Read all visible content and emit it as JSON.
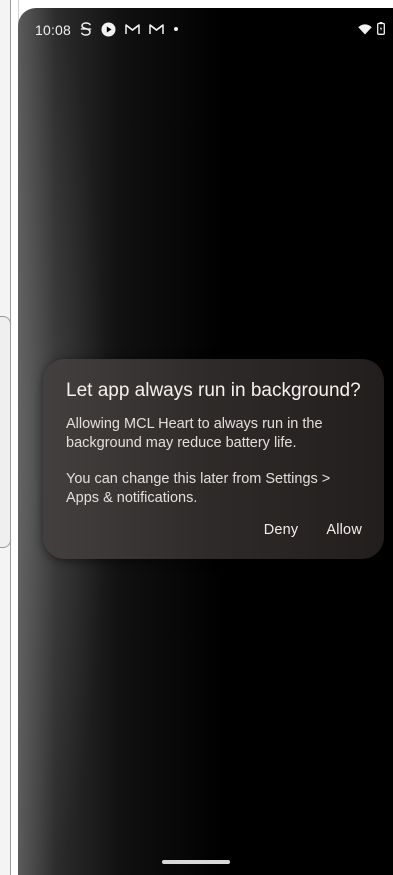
{
  "status_bar": {
    "time": "10:08",
    "left_icons": [
      "s-app-icon",
      "play-circle-icon",
      "gmail-icon",
      "gmail-icon",
      "dot-icon"
    ],
    "right_icons": [
      "wifi-icon",
      "battery-icon"
    ]
  },
  "dialog": {
    "title": "Let app always run in background?",
    "message_1": "Allowing MCL Heart to always run in the background may reduce battery life.",
    "message_2": "You can change this later from Settings > Apps & notifications.",
    "deny_label": "Deny",
    "allow_label": "Allow"
  },
  "colors": {
    "dialog_bg": "#2e2a29",
    "text": "#ffffff",
    "screen_bg": "#000000"
  }
}
